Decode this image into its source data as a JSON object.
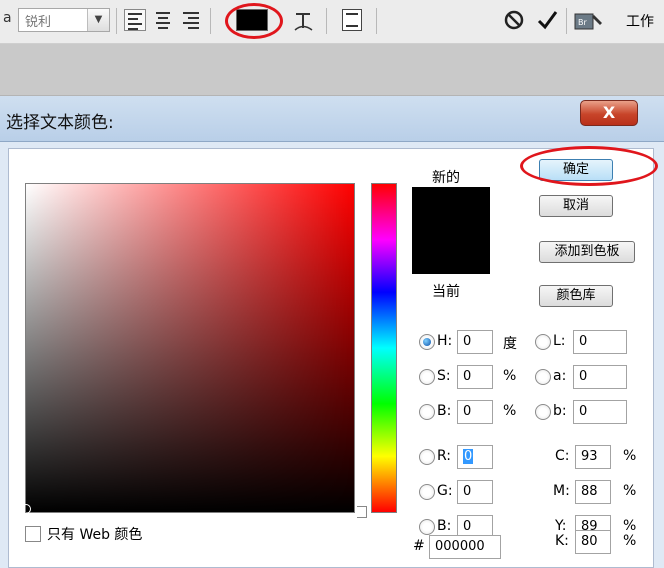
{
  "toolbar": {
    "aa_prefix": "a",
    "aa_value": "锐利",
    "text_color": "#000000",
    "work_label": "工作",
    "highlight_color": "#e0161c"
  },
  "dialog": {
    "title": "选择文本颜色:",
    "close_label": "X",
    "buttons": {
      "ok": "确定",
      "cancel": "取消",
      "add_swatch": "添加到色板",
      "libraries": "颜色库"
    },
    "preview": {
      "new_label": "新的",
      "current_label": "当前",
      "new_color": "#000000",
      "current_color": "#000000"
    },
    "web_only_label": "只有 Web 颜色",
    "web_only_checked": false,
    "selected_mode": "H",
    "hsb": [
      {
        "label": "H:",
        "value": "0",
        "unit": "度"
      },
      {
        "label": "S:",
        "value": "0",
        "unit": "%"
      },
      {
        "label": "B:",
        "value": "0",
        "unit": "%"
      }
    ],
    "lab": [
      {
        "label": "L:",
        "value": "0"
      },
      {
        "label": "a:",
        "value": "0"
      },
      {
        "label": "b:",
        "value": "0"
      }
    ],
    "rgb": [
      {
        "label": "R:",
        "value": "0"
      },
      {
        "label": "G:",
        "value": "0"
      },
      {
        "label": "B:",
        "value": "0"
      }
    ],
    "cmyk": [
      {
        "label": "C:",
        "value": "93",
        "unit": "%"
      },
      {
        "label": "M:",
        "value": "88",
        "unit": "%"
      },
      {
        "label": "Y:",
        "value": "89",
        "unit": "%"
      },
      {
        "label": "K:",
        "value": "80",
        "unit": "%"
      }
    ],
    "hex_label": "#",
    "hex_value": "000000"
  }
}
